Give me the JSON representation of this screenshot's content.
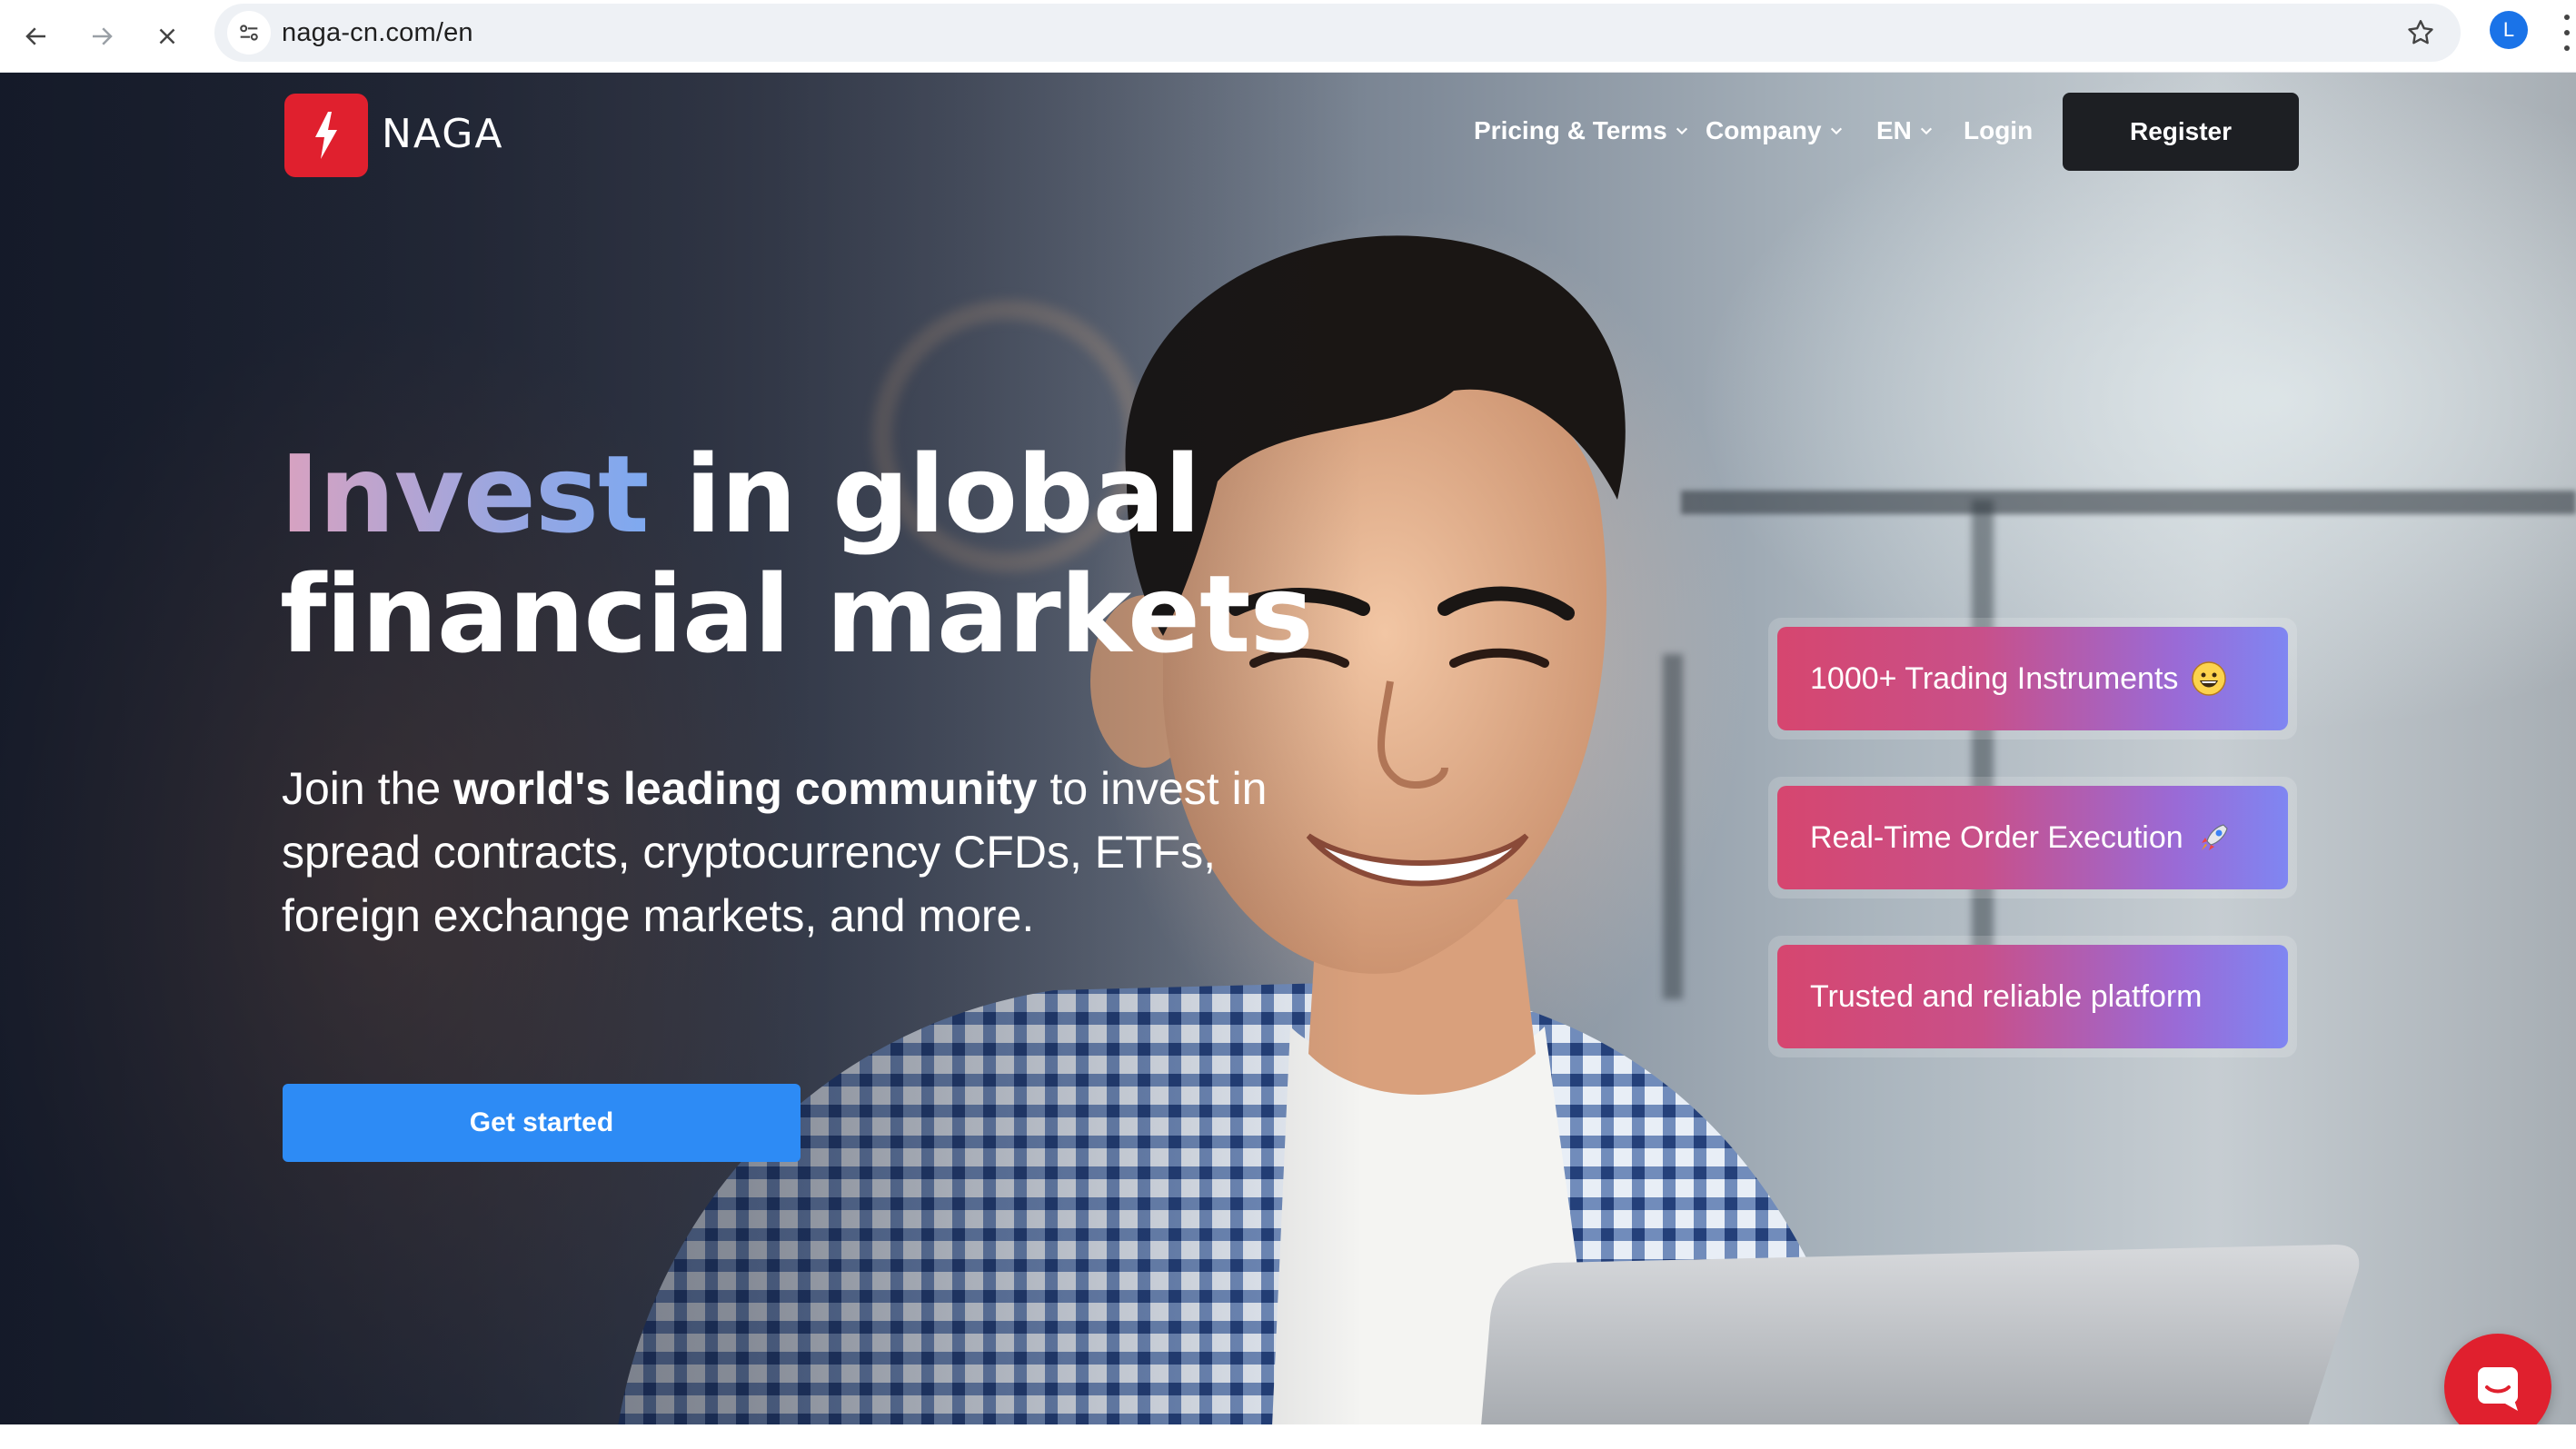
{
  "browser": {
    "url": "naga-cn.com/en",
    "profile_initial": "L"
  },
  "header": {
    "brand": "NAGA",
    "menu": {
      "pricing": "Pricing & Terms",
      "company": "Company",
      "language": "EN",
      "login": "Login"
    },
    "register": "Register"
  },
  "hero": {
    "headline_accent": "Invest",
    "headline_line1_rest": " in global",
    "headline_line2": "financial markets",
    "sub_lead": "Join the ",
    "sub_bold": "world's leading community",
    "sub_rest": " to invest in spread contracts, cryptocurrency CFDs, ETFs, foreign exchange markets, and more.",
    "cta": "Get started"
  },
  "features": [
    {
      "label": "1000+ Trading Instruments",
      "icon": "grinning-face-emoji"
    },
    {
      "label": "Real-Time Order Execution",
      "icon": "rocket-emoji"
    },
    {
      "label": "Trusted and reliable platform",
      "icon": ""
    }
  ],
  "colors": {
    "brand_red": "#e0202e",
    "cta_blue": "#2d8bf5",
    "register_bg": "#1d1f23",
    "pill_start": "#d6466f",
    "pill_end": "#7f86f2"
  }
}
